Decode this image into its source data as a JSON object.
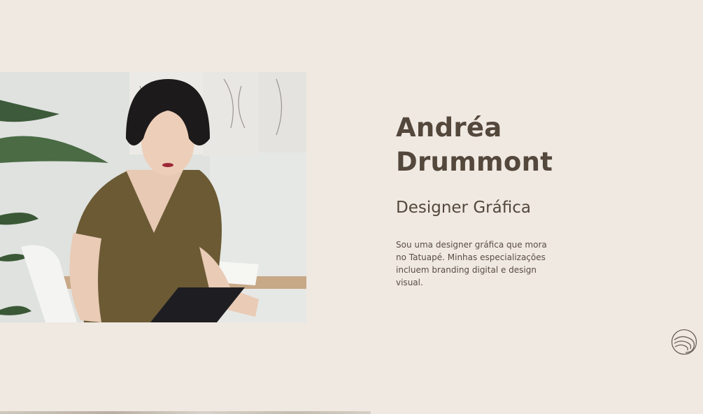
{
  "profile": {
    "name_line1": "Andréa",
    "name_line2": "Drummont",
    "role": "Designer Gráfica",
    "bio": "Sou uma designer gráfica que mora no Tatuapé. Minhas especializações incluem branding digital e design visual."
  },
  "icons": {
    "logo": "concentric-arcs-logo-icon"
  },
  "colors": {
    "background": "#efe9e2",
    "text": "#54473b"
  }
}
